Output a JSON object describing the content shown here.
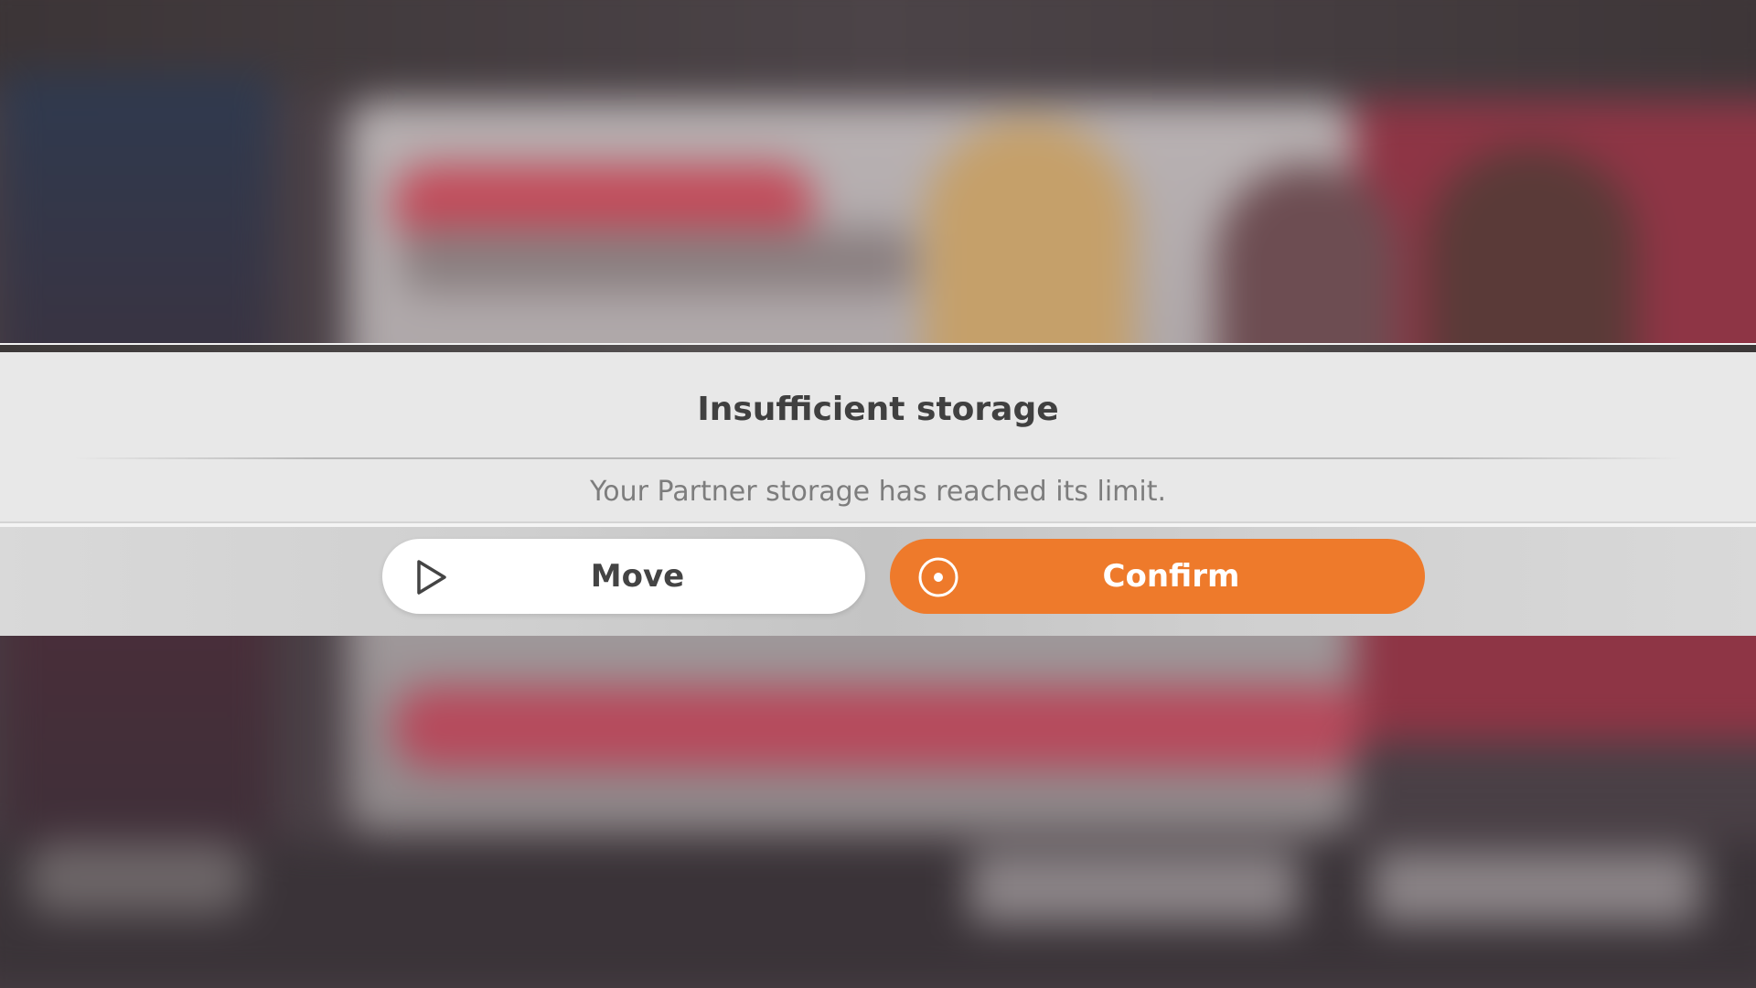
{
  "dialog": {
    "title": "Insufficient storage",
    "message": "Your Partner storage has reached its limit."
  },
  "buttons": {
    "move": {
      "label": "Move",
      "icon": "play-triangle-icon"
    },
    "confirm": {
      "label": "Confirm",
      "icon": "target-circle-icon"
    }
  },
  "colors": {
    "confirm_accent": "#ee7a2b",
    "dialog_background": "#e8e8e8",
    "title_text": "#404040",
    "message_text": "#7d7d7d"
  }
}
